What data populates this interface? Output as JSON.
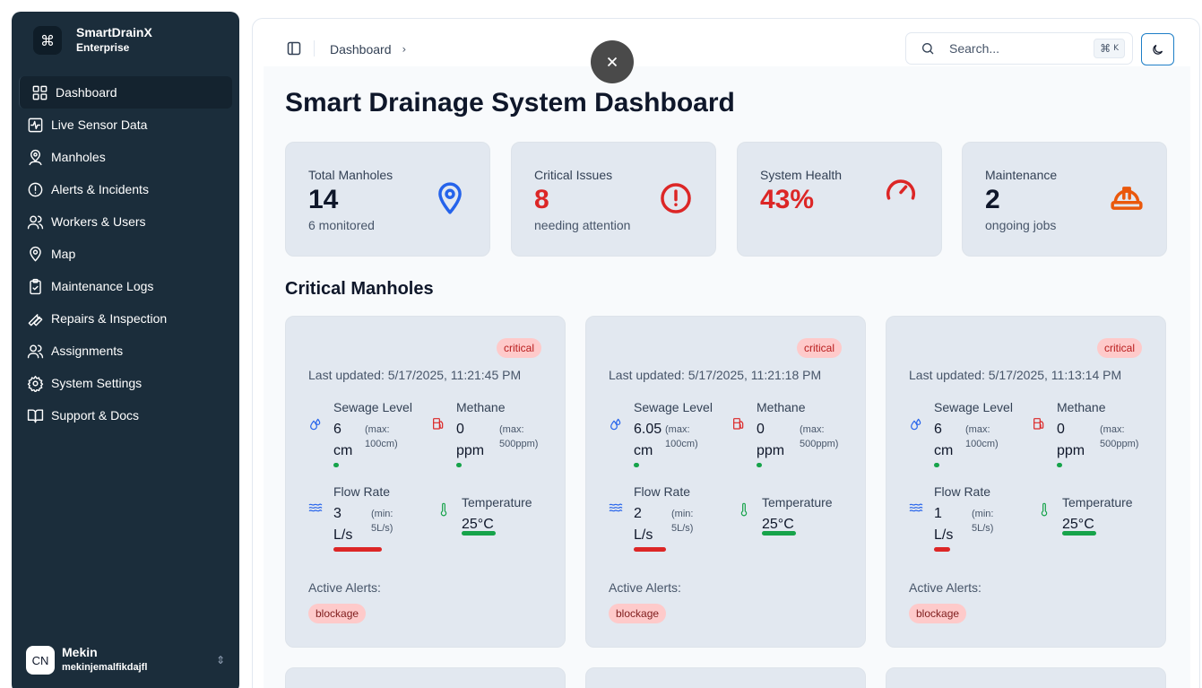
{
  "brand": {
    "name": "SmartDrainX",
    "tier": "Enterprise",
    "logo_icon": "command-icon"
  },
  "sidebar": {
    "items": [
      {
        "label": "Dashboard",
        "icon": "grid-icon",
        "active": true
      },
      {
        "label": "Live Sensor Data",
        "icon": "activity-icon"
      },
      {
        "label": "Manholes",
        "icon": "map-pin-user-icon"
      },
      {
        "label": "Alerts & Incidents",
        "icon": "alert-circle-icon"
      },
      {
        "label": "Workers & Users",
        "icon": "users-icon"
      },
      {
        "label": "Map",
        "icon": "map-pin-icon"
      },
      {
        "label": "Maintenance Logs",
        "icon": "clipboard-check-icon"
      },
      {
        "label": "Repairs & Inspection",
        "icon": "wrench-icon"
      },
      {
        "label": "Assignments",
        "icon": "users-icon"
      },
      {
        "label": "System Settings",
        "icon": "gear-icon"
      },
      {
        "label": "Support & Docs",
        "icon": "book-open-icon"
      }
    ]
  },
  "user": {
    "initials": "CN",
    "name": "Mekin",
    "email": "mekinjemalfikdajfl"
  },
  "header": {
    "breadcrumb": "Dashboard",
    "search_placeholder": "Search...",
    "shortcut": "⌘",
    "shortcut_key": "K"
  },
  "page": {
    "title": "Smart Drainage System Dashboard",
    "section_title": "Critical Manholes"
  },
  "stats": [
    {
      "label": "Total Manholes",
      "value": "14",
      "sub": "6 monitored",
      "icon": "map-pin-icon",
      "color": "#2563eb"
    },
    {
      "label": "Critical Issues",
      "value": "8",
      "sub": "needing attention",
      "icon": "alert-circle-icon",
      "color": "#dc2626"
    },
    {
      "label": "System Health",
      "value": "43%",
      "sub": "",
      "icon": "gauge-icon",
      "color": "#dc2626"
    },
    {
      "label": "Maintenance",
      "value": "2",
      "sub": "ongoing jobs",
      "icon": "hard-hat-icon",
      "color": "#ea580c"
    }
  ],
  "cards": [
    {
      "status": "critical",
      "updated": "Last updated: 5/17/2025, 11:21:45 PM",
      "sewage": {
        "label": "Sewage Level",
        "value": "6",
        "unit": "cm",
        "max_a": "(max:",
        "max_b": "100cm)",
        "level": 0.06
      },
      "methane": {
        "label": "Methane",
        "value": "0",
        "unit": "ppm",
        "max_a": "(max:",
        "max_b": "500ppm)",
        "level": 0.0
      },
      "flow": {
        "label": "Flow Rate",
        "value": "3",
        "unit": "L/s",
        "max_a": "(min:",
        "max_b": "5L/s)",
        "level": 0.6
      },
      "temp": {
        "label": "Temperature",
        "value": "25°C",
        "level": 0.48
      },
      "alerts_label": "Active Alerts:",
      "alert": "blockage"
    },
    {
      "status": "critical",
      "updated": "Last updated: 5/17/2025, 11:21:18 PM",
      "sewage": {
        "label": "Sewage Level",
        "value": "6.05",
        "unit": "cm",
        "max_a": "(max:",
        "max_b": "100cm)",
        "level": 0.06
      },
      "methane": {
        "label": "Methane",
        "value": "0",
        "unit": "ppm",
        "max_a": "(max:",
        "max_b": "500ppm)",
        "level": 0.0
      },
      "flow": {
        "label": "Flow Rate",
        "value": "2",
        "unit": "L/s",
        "max_a": "(min:",
        "max_b": "5L/s)",
        "level": 0.4
      },
      "temp": {
        "label": "Temperature",
        "value": "25°C",
        "level": 0.48
      },
      "alerts_label": "Active Alerts:",
      "alert": "blockage"
    },
    {
      "status": "critical",
      "updated": "Last updated: 5/17/2025, 11:13:14 PM",
      "sewage": {
        "label": "Sewage Level",
        "value": "6",
        "unit": "cm",
        "max_a": "(max:",
        "max_b": "100cm)",
        "level": 0.06
      },
      "methane": {
        "label": "Methane",
        "value": "0",
        "unit": "ppm",
        "max_a": "(max:",
        "max_b": "500ppm)",
        "level": 0.0
      },
      "flow": {
        "label": "Flow Rate",
        "value": "1",
        "unit": "L/s",
        "max_a": "(min:",
        "max_b": "5L/s)",
        "level": 0.2
      },
      "temp": {
        "label": "Temperature",
        "value": "25°C",
        "level": 0.48
      },
      "alerts_label": "Active Alerts:",
      "alert": "blockage"
    }
  ],
  "colors": {
    "sidebar": "#1b2d3b",
    "critical": "#dc2626",
    "ok": "#16a34a",
    "accent": "#2563eb",
    "water": "#2563eb",
    "warning": "#ea580c"
  }
}
